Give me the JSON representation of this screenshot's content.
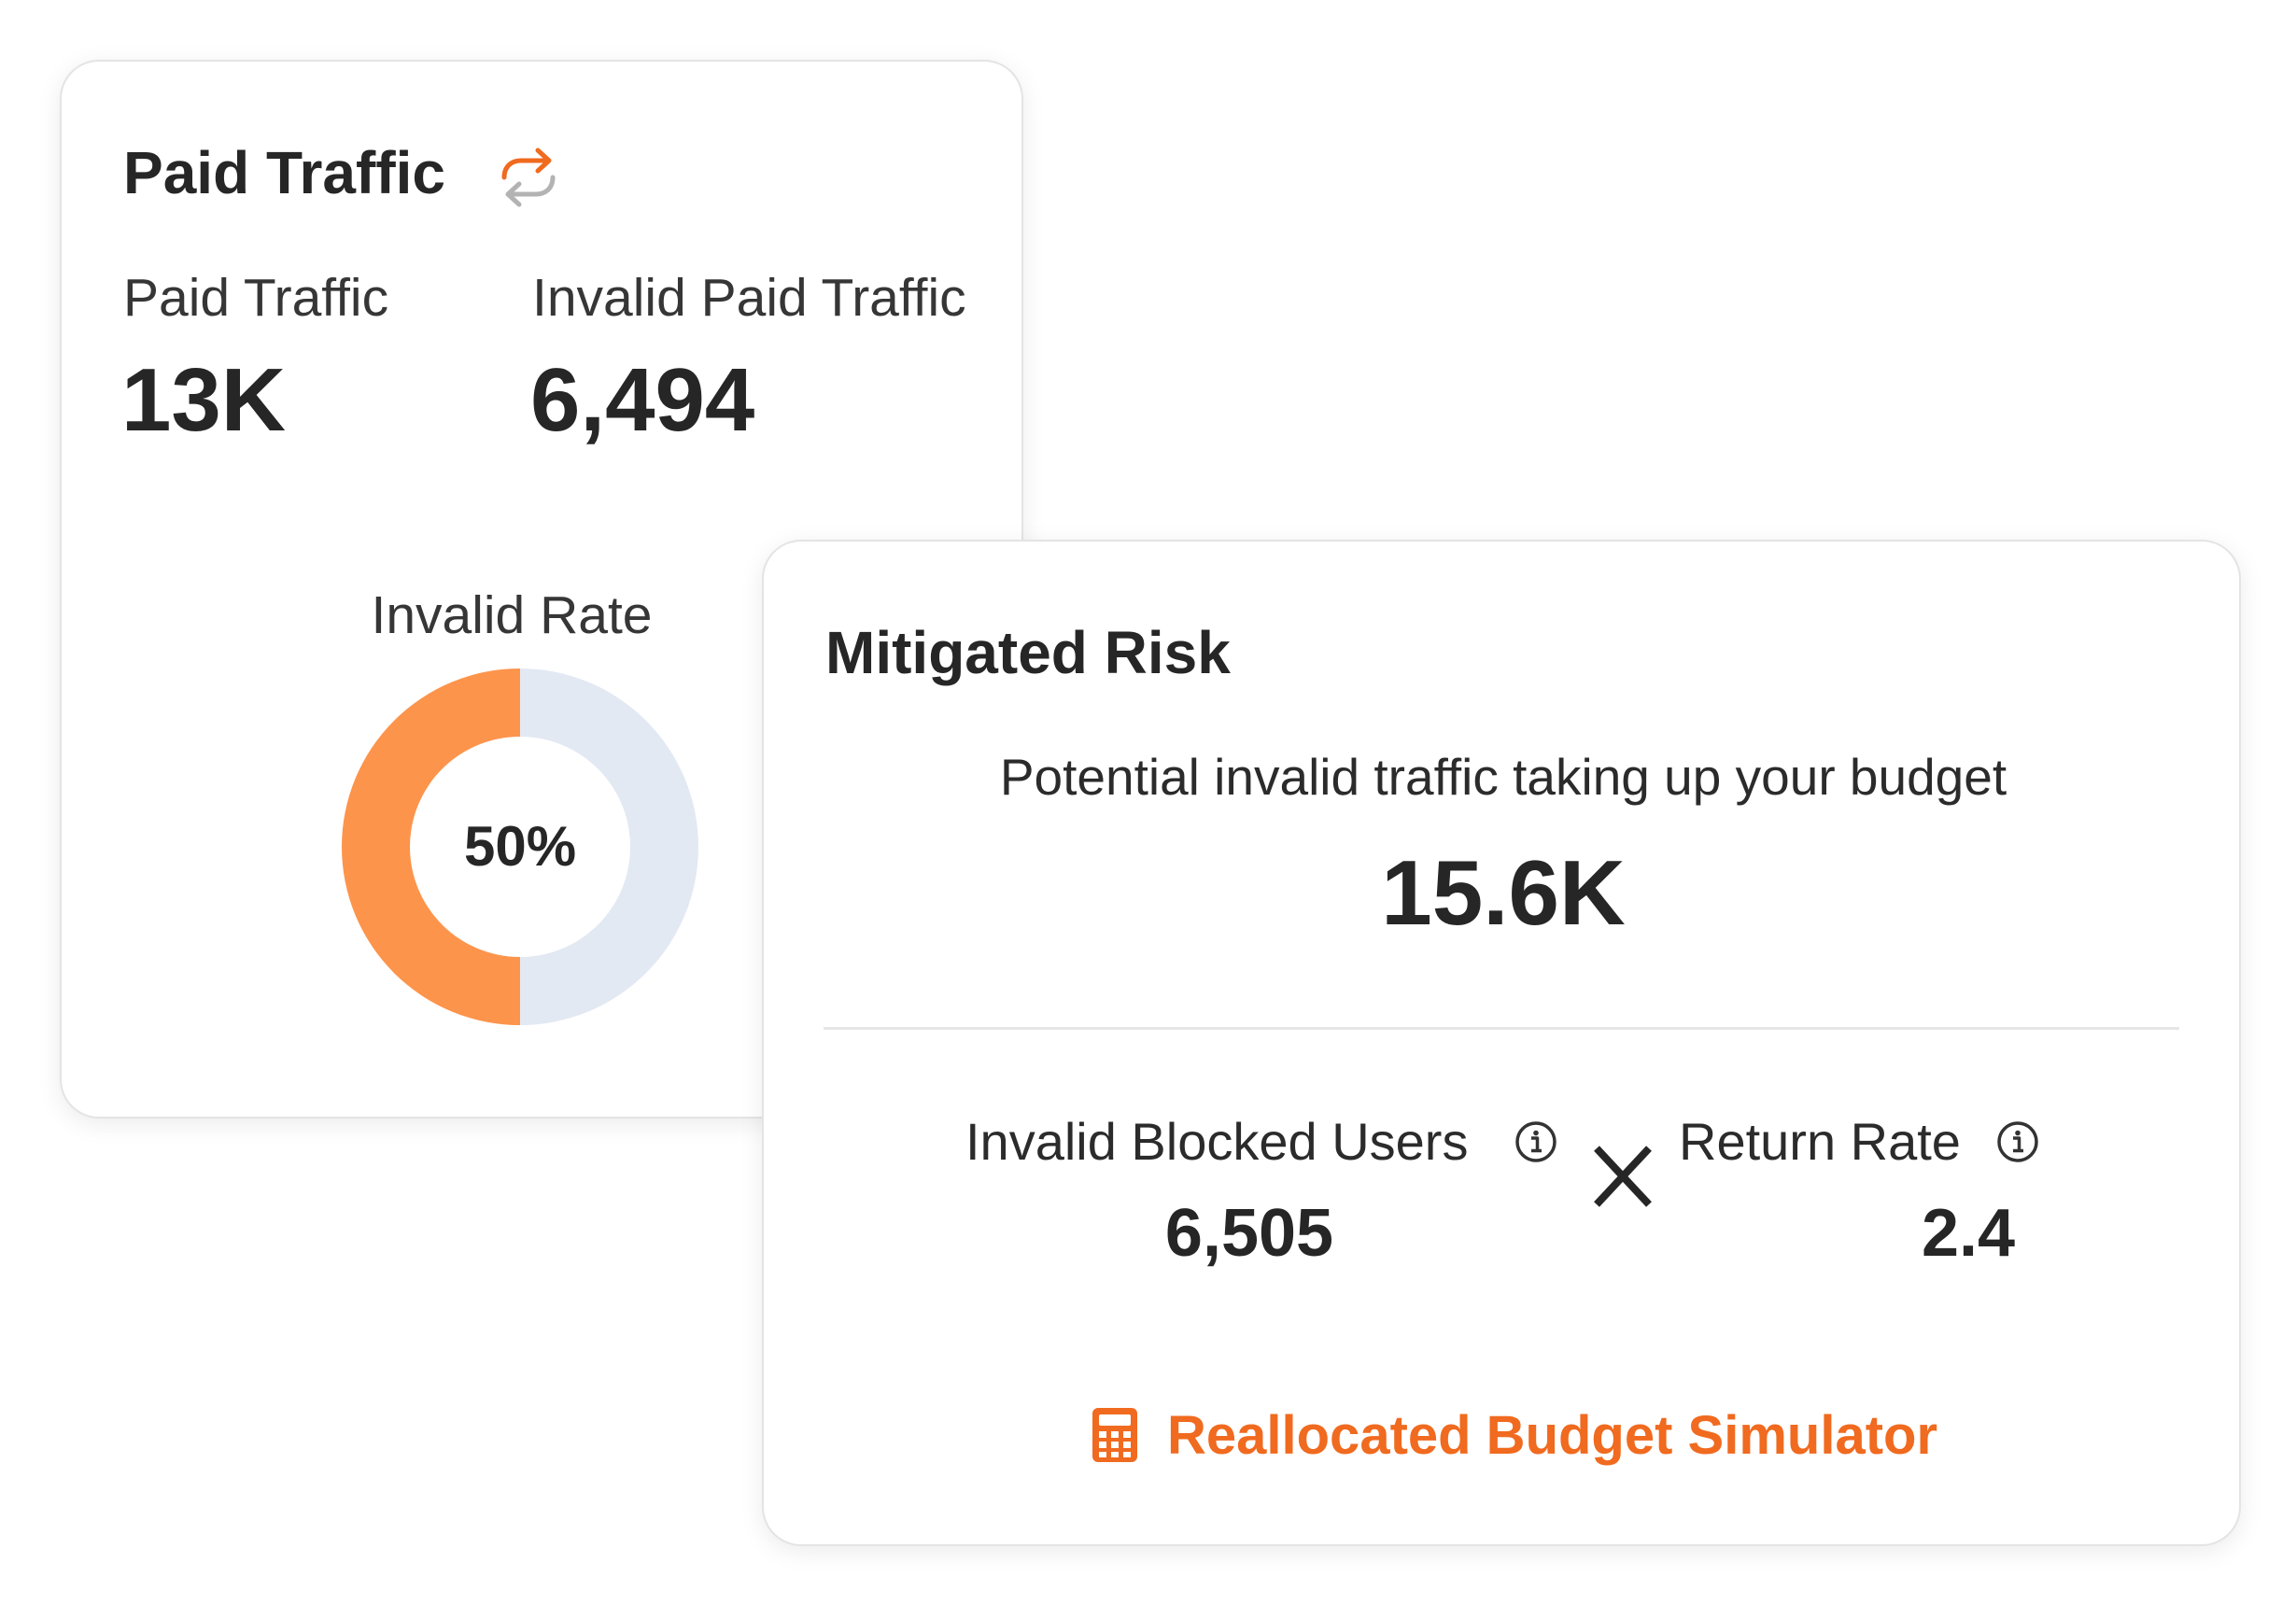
{
  "paid_traffic_card": {
    "title": "Paid Traffic",
    "refresh_icon": "refresh-icon",
    "paid_traffic_label": "Paid Traffic",
    "paid_traffic_value": "13K",
    "invalid_paid_traffic_label": "Invalid Paid Traffic",
    "invalid_paid_traffic_value": "6,494",
    "invalid_rate_label": "Invalid Rate",
    "invalid_rate_text": "50%",
    "invalid_rate_fraction": 0.5
  },
  "mitigated_risk_card": {
    "title": "Mitigated Risk",
    "description": "Potential invalid traffic taking up your budget",
    "value": "15.6K",
    "invalid_blocked_users_label": "Invalid Blocked Users",
    "invalid_blocked_users_value": "6,505",
    "operator_icon": "multiply-icon",
    "return_rate_label": "Return Rate",
    "return_rate_value": "2.4",
    "info_icon": "info-icon",
    "simulator_label": "Reallocated Budget Simulator",
    "simulator_icon": "calculator-icon"
  },
  "colors": {
    "accent": "#f06a1f",
    "donut_invalid": "#fd944b",
    "donut_valid": "#e3e9f3",
    "text": "#262626",
    "card_border": "#e4e4e4"
  }
}
